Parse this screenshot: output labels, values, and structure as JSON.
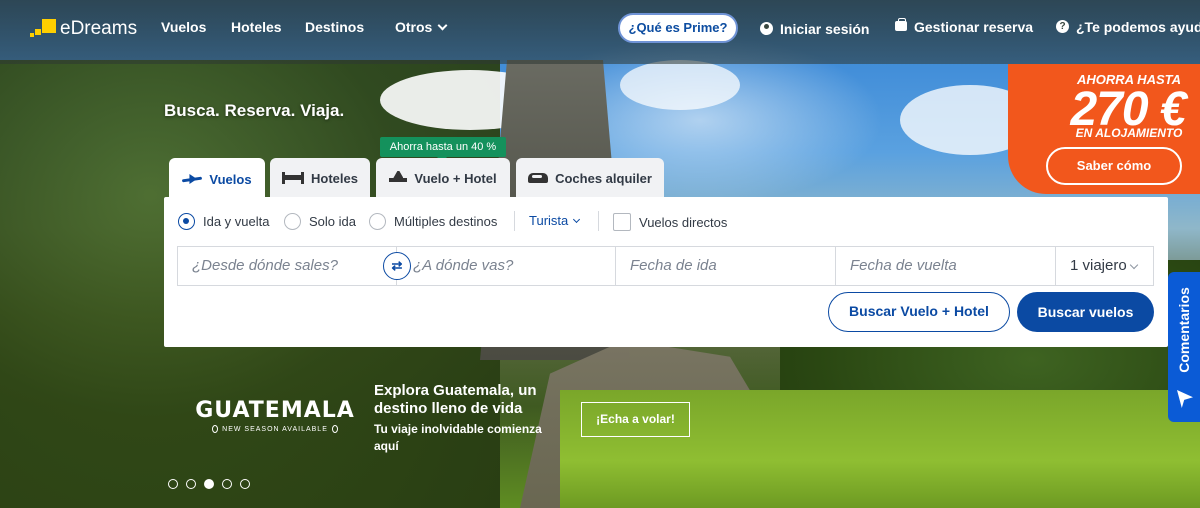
{
  "brand": {
    "name": "eDreams",
    "logo_color": "#ffcf00"
  },
  "nav": {
    "items": [
      {
        "label": "Vuelos"
      },
      {
        "label": "Hoteles"
      },
      {
        "label": "Destinos"
      },
      {
        "label": "Otros"
      }
    ],
    "prime": "¿Qué es Prime?",
    "login": "Iniciar sesión",
    "manage": "Gestionar reserva",
    "help": "¿Te podemos ayudar?"
  },
  "promo": {
    "line1": "AHORRA HASTA",
    "amount": "270 €",
    "line3": "EN ALOJAMIENTO",
    "button": "Saber cómo",
    "color": "#f2571c"
  },
  "hero": {
    "tagline": "Busca. Reserva. Viaja."
  },
  "tabs": [
    {
      "label": "Vuelos",
      "icon": "plane-icon",
      "active": true
    },
    {
      "label": "Hoteles",
      "icon": "bed-icon",
      "active": false
    },
    {
      "label": "Vuelo + Hotel",
      "icon": "plane-hotel-icon",
      "active": false
    },
    {
      "label": "Coches alquiler",
      "icon": "car-icon",
      "active": false
    }
  ],
  "save_badge": "Ahorra hasta un 40 %",
  "search": {
    "trip_types": [
      {
        "label": "Ida y vuelta",
        "selected": true
      },
      {
        "label": "Solo ida",
        "selected": false
      },
      {
        "label": "Múltiples destinos",
        "selected": false
      }
    ],
    "cabin_class": "Turista",
    "direct_flights": {
      "label": "Vuelos directos",
      "checked": false
    },
    "origin_placeholder": "¿Desde dónde sales?",
    "destination_placeholder": "¿A dónde vas?",
    "departure_placeholder": "Fecha de ida",
    "return_placeholder": "Fecha de vuelta",
    "travellers": "1 viajero",
    "swap_icon": "swap-arrows-icon",
    "btn_flight_hotel": "Buscar Vuelo + Hotel",
    "btn_flights": "Buscar vuelos",
    "accent": "#0b4aa3"
  },
  "banner": {
    "logo_word": "GUATEMALA",
    "logo_sub": "NEW SEASON AVAILABLE",
    "title": "Explora Guatemala, un destino lleno de vida",
    "description": "Tu viaje inolvidable comienza aquí",
    "cta": "¡Echa a volar!",
    "slides": 5,
    "active_slide": 3
  },
  "feedback": {
    "label": "Comentarios",
    "color": "#0b5bd6"
  }
}
